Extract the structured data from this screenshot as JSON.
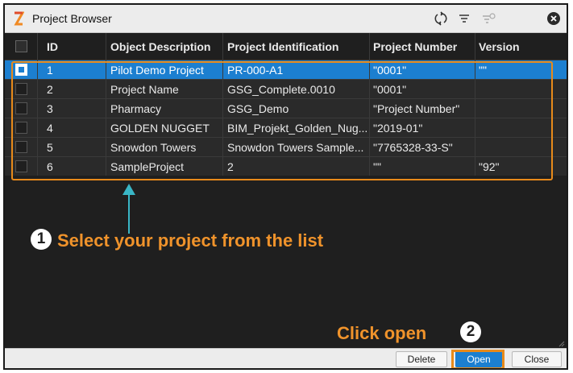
{
  "window": {
    "title": "Project Browser"
  },
  "toolbar": {
    "icons": [
      "refresh-icon",
      "filter-icon",
      "filter-clear-icon",
      "close-icon"
    ]
  },
  "table": {
    "columns": [
      "ID",
      "Object Description",
      "Project Identification",
      "Project Number",
      "Version"
    ],
    "rows": [
      {
        "selected": true,
        "id": "1",
        "description": "Pilot Demo Project",
        "identification": "PR-000-A1",
        "number": "\"0001\"",
        "version": "\"\""
      },
      {
        "selected": false,
        "id": "2",
        "description": "Project Name",
        "identification": "GSG_Complete.0010",
        "number": "\"0001\"",
        "version": ""
      },
      {
        "selected": false,
        "id": "3",
        "description": "Pharmacy",
        "identification": "GSG_Demo",
        "number": "\"Project Number\"",
        "version": ""
      },
      {
        "selected": false,
        "id": "4",
        "description": "GOLDEN NUGGET",
        "identification": "BIM_Projekt_Golden_Nug...",
        "number": "\"2019-01\"",
        "version": ""
      },
      {
        "selected": false,
        "id": "5",
        "description": "Snowdon Towers",
        "identification": "Snowdon Towers Sample...",
        "number": "\"7765328-33-S\"",
        "version": ""
      },
      {
        "selected": false,
        "id": "6",
        "description": "SampleProject",
        "identification": "2",
        "number": "\"\"",
        "version": "\"92\""
      }
    ]
  },
  "annotations": {
    "step1_number": "1",
    "step1_text": "Select your project from the list",
    "step2_text": "Click open",
    "step2_number": "2",
    "accent_color": "#f0932b",
    "arrow_color": "#39b6c6"
  },
  "footer": {
    "delete_label": "Delete",
    "open_label": "Open",
    "close_label": "Close"
  },
  "colors": {
    "selection": "#1c7fd0",
    "background": "#1f1f1f",
    "titlebar": "#ececec"
  }
}
